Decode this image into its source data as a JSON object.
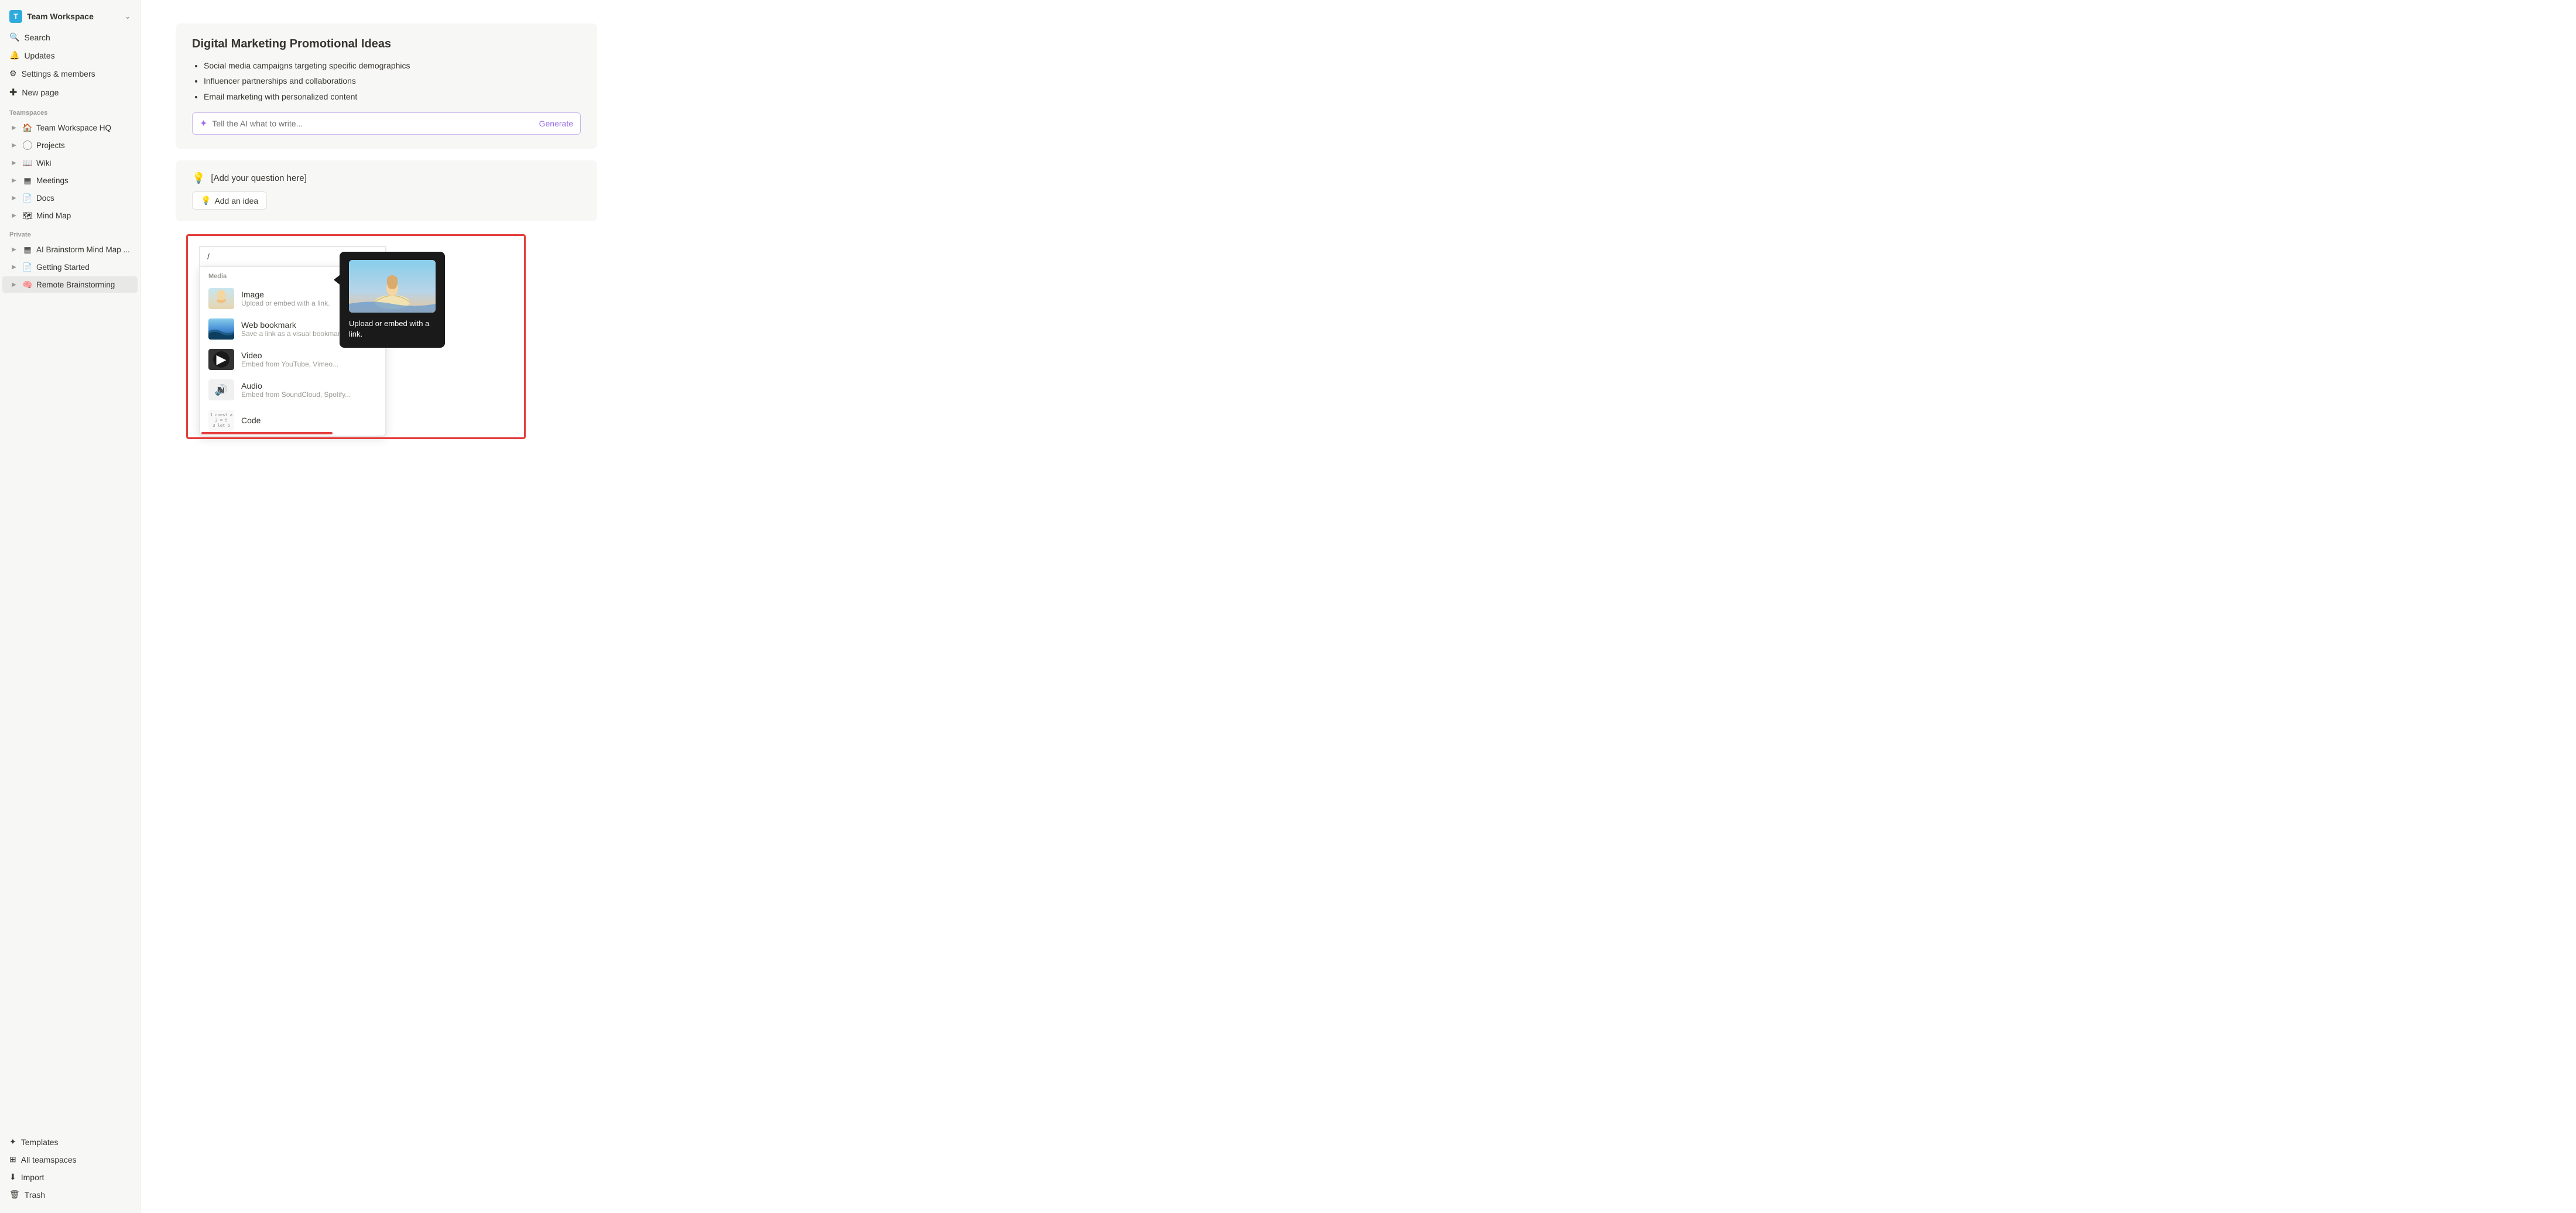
{
  "workspace": {
    "avatar_letter": "T",
    "name": "Team Workspace",
    "chevron": "❯"
  },
  "sidebar": {
    "top_items": [
      {
        "id": "search",
        "label": "Search",
        "icon": "🔍"
      },
      {
        "id": "updates",
        "label": "Updates",
        "icon": "🔔"
      },
      {
        "id": "settings",
        "label": "Settings & members",
        "icon": "⚙"
      },
      {
        "id": "new-page",
        "label": "New page",
        "icon": "+"
      }
    ],
    "teamspaces_label": "Teamspaces",
    "teamspaces": [
      {
        "id": "team-hq",
        "label": "Team Workspace HQ",
        "icon": "🏠",
        "emoji": true
      },
      {
        "id": "projects",
        "label": "Projects",
        "icon": "◎"
      },
      {
        "id": "wiki",
        "label": "Wiki",
        "icon": "📖"
      },
      {
        "id": "meetings",
        "label": "Meetings",
        "icon": "▦"
      },
      {
        "id": "docs",
        "label": "Docs",
        "icon": "📄"
      },
      {
        "id": "mind-map",
        "label": "Mind Map",
        "icon": "🗺"
      }
    ],
    "private_label": "Private",
    "private_items": [
      {
        "id": "ai-brainstorm",
        "label": "AI Brainstorm Mind Map ...",
        "icon": "▦"
      },
      {
        "id": "getting-started",
        "label": "Getting Started",
        "icon": "📄"
      },
      {
        "id": "remote-brainstorming",
        "label": "Remote Brainstorming",
        "icon": "🧠",
        "active": true
      }
    ],
    "bottom_items": [
      {
        "id": "templates",
        "label": "Templates",
        "icon": "✦"
      },
      {
        "id": "all-teamspaces",
        "label": "All teamspaces",
        "icon": "⊞"
      },
      {
        "id": "import",
        "label": "Import",
        "icon": "⬇"
      },
      {
        "id": "trash",
        "label": "Trash",
        "icon": "🗑"
      }
    ]
  },
  "main": {
    "ai_card": {
      "title": "Digital Marketing Promotional Ideas",
      "bullets": [
        "Social media campaigns targeting specific demographics",
        "Influencer partnerships and collaborations",
        "Email marketing with personalized content"
      ],
      "ai_input_placeholder": "Tell the AI what to write...",
      "generate_label": "Generate"
    },
    "question_card": {
      "bulb_icon": "💡",
      "question_text": "[Add your question here]",
      "add_idea_label": "Add an idea",
      "add_idea_icon": "💡"
    },
    "slash_menu": {
      "input_value": "/",
      "section_label": "Media",
      "items": [
        {
          "id": "image",
          "title": "Image",
          "desc": "Upload or embed with a link.",
          "thumb_type": "portrait"
        },
        {
          "id": "web-bookmark",
          "title": "Web bookmark",
          "desc": "Save a link as a visual bookmark.",
          "thumb_type": "wave"
        },
        {
          "id": "video",
          "title": "Video",
          "desc": "Embed from YouTube, Vimeo...",
          "thumb_type": "video"
        },
        {
          "id": "audio",
          "title": "Audio",
          "desc": "Embed from SoundCloud, Spotify...",
          "thumb_type": "audio"
        },
        {
          "id": "code",
          "title": "Code",
          "desc": "",
          "thumb_type": "code"
        }
      ]
    },
    "tooltip": {
      "text": "Upload or embed with a link."
    }
  }
}
